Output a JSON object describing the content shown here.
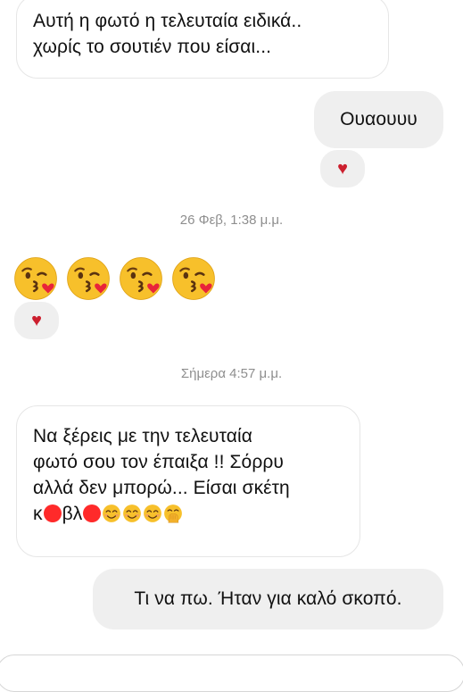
{
  "messages": [
    {
      "sender": "them",
      "lines": [
        "Αυτή η φωτό η τελευταία ειδικά..",
        "χωρίς το σουτιέν που είσαι..."
      ]
    },
    {
      "sender": "me",
      "text": "Ουαουυυ",
      "reaction": "heart"
    },
    {
      "timestamp": "26 Φεβ, 1:38 μ.μ."
    },
    {
      "sender": "them",
      "emoji": [
        "face-blowing-a-kiss",
        "face-blowing-a-kiss",
        "face-blowing-a-kiss",
        "face-blowing-a-kiss"
      ],
      "reaction": "heart"
    },
    {
      "timestamp": "Σήμερα 4:57 μ.μ."
    },
    {
      "sender": "them",
      "lines": [
        "Να ξέρεις με την τελευταία",
        "φωτό σου τον έπαιξα !! Σόρρυ",
        "αλλά δεν μπορώ... Είσαι σκέτη"
      ],
      "last_line": {
        "prefix": "κ",
        "middle": "βλ",
        "redactions": 2,
        "emoji": [
          "smiling-face-with-smiling-eyes",
          "smiling-face-with-smiling-eyes",
          "smiling-face-with-smiling-eyes",
          "face-with-hand-over-mouth"
        ]
      }
    },
    {
      "sender": "me",
      "text": "Τι να πω. Ήταν για καλό σκοπό."
    }
  ],
  "reaction_symbol": "♥",
  "colors": {
    "outgoing_bubble": "#efefef",
    "incoming_border": "#e6e6e6",
    "heart": "#cc1f2e",
    "redaction": "#ff2a2a",
    "timestamp": "#8e8e8e"
  }
}
